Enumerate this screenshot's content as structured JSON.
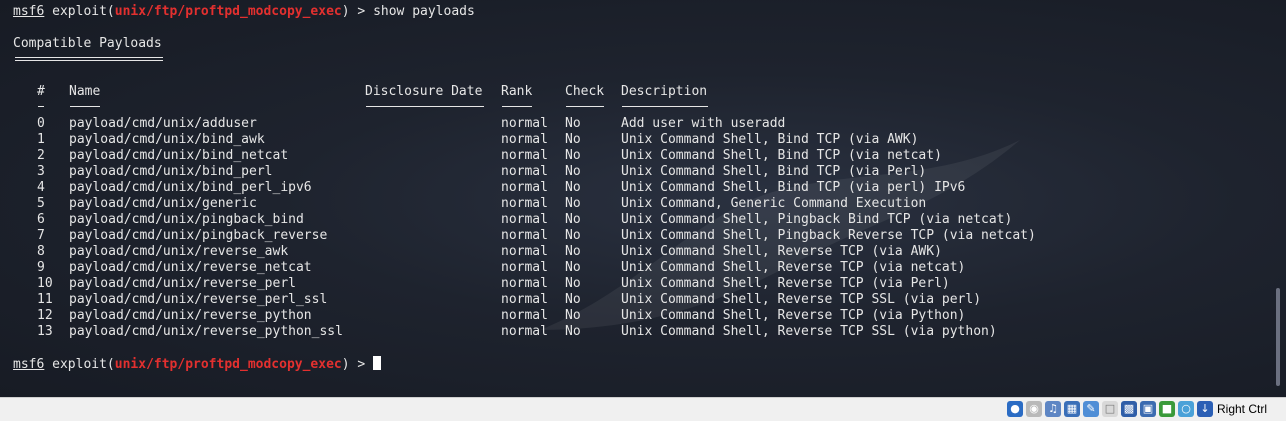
{
  "prompt1": {
    "prefix": "msf6",
    "exploit_open": " exploit(",
    "module": "unix/ftp/proftpd_modcopy_exec",
    "close": ") > ",
    "command": "show payloads"
  },
  "section_title": "Compatible Payloads",
  "table": {
    "headers": {
      "num": "#",
      "name": "Name",
      "date": "Disclosure Date",
      "rank": "Rank",
      "check": "Check",
      "desc": "Description"
    },
    "rows": [
      {
        "num": "0",
        "name": "payload/cmd/unix/adduser",
        "date": "",
        "rank": "normal",
        "check": "No",
        "desc": "Add user with useradd"
      },
      {
        "num": "1",
        "name": "payload/cmd/unix/bind_awk",
        "date": "",
        "rank": "normal",
        "check": "No",
        "desc": "Unix Command Shell, Bind TCP (via AWK)"
      },
      {
        "num": "2",
        "name": "payload/cmd/unix/bind_netcat",
        "date": "",
        "rank": "normal",
        "check": "No",
        "desc": "Unix Command Shell, Bind TCP (via netcat)"
      },
      {
        "num": "3",
        "name": "payload/cmd/unix/bind_perl",
        "date": "",
        "rank": "normal",
        "check": "No",
        "desc": "Unix Command Shell, Bind TCP (via Perl)"
      },
      {
        "num": "4",
        "name": "payload/cmd/unix/bind_perl_ipv6",
        "date": "",
        "rank": "normal",
        "check": "No",
        "desc": "Unix Command Shell, Bind TCP (via perl) IPv6"
      },
      {
        "num": "5",
        "name": "payload/cmd/unix/generic",
        "date": "",
        "rank": "normal",
        "check": "No",
        "desc": "Unix Command, Generic Command Execution"
      },
      {
        "num": "6",
        "name": "payload/cmd/unix/pingback_bind",
        "date": "",
        "rank": "normal",
        "check": "No",
        "desc": "Unix Command Shell, Pingback Bind TCP (via netcat)"
      },
      {
        "num": "7",
        "name": "payload/cmd/unix/pingback_reverse",
        "date": "",
        "rank": "normal",
        "check": "No",
        "desc": "Unix Command Shell, Pingback Reverse TCP (via netcat)"
      },
      {
        "num": "8",
        "name": "payload/cmd/unix/reverse_awk",
        "date": "",
        "rank": "normal",
        "check": "No",
        "desc": "Unix Command Shell, Reverse TCP (via AWK)"
      },
      {
        "num": "9",
        "name": "payload/cmd/unix/reverse_netcat",
        "date": "",
        "rank": "normal",
        "check": "No",
        "desc": "Unix Command Shell, Reverse TCP (via netcat)"
      },
      {
        "num": "10",
        "name": "payload/cmd/unix/reverse_perl",
        "date": "",
        "rank": "normal",
        "check": "No",
        "desc": "Unix Command Shell, Reverse TCP (via Perl)"
      },
      {
        "num": "11",
        "name": "payload/cmd/unix/reverse_perl_ssl",
        "date": "",
        "rank": "normal",
        "check": "No",
        "desc": "Unix Command Shell, Reverse TCP SSL (via perl)"
      },
      {
        "num": "12",
        "name": "payload/cmd/unix/reverse_python",
        "date": "",
        "rank": "normal",
        "check": "No",
        "desc": "Unix Command Shell, Reverse TCP (via Python)"
      },
      {
        "num": "13",
        "name": "payload/cmd/unix/reverse_python_ssl",
        "date": "",
        "rank": "normal",
        "check": "No",
        "desc": "Unix Command Shell, Reverse TCP SSL (via python)"
      }
    ]
  },
  "prompt2": {
    "prefix": "msf6",
    "exploit_open": " exploit(",
    "module": "unix/ftp/proftpd_modcopy_exec",
    "close": ") > "
  },
  "statusbar": {
    "host_key_label": "Right Ctrl",
    "icons": [
      "hard-disk-icon",
      "optical-drive-icon",
      "audio-icon",
      "network-icon",
      "usb-icon",
      "shared-folders-icon",
      "display-icon",
      "video-capture-icon",
      "cpu-icon",
      "mouse-integration-icon",
      "keyboard-arrow-icon"
    ]
  },
  "colors": {
    "background": "#1e232e",
    "text": "#e6e6e6",
    "module": "#e3302f"
  }
}
